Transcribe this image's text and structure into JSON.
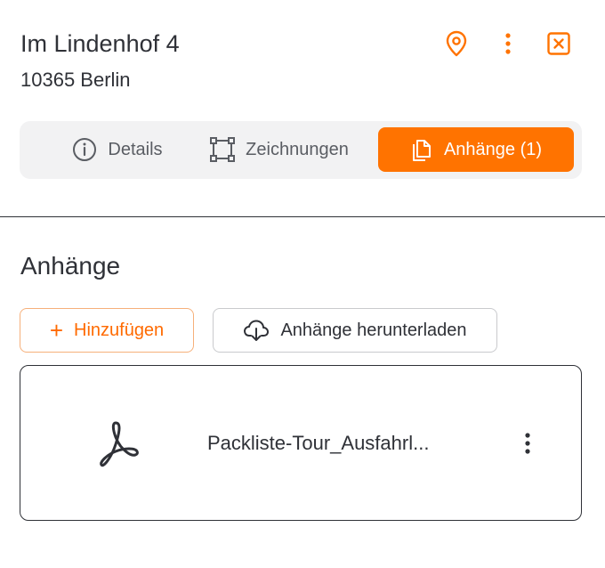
{
  "header": {
    "title": "Im Lindenhof 4",
    "subtitle": "10365 Berlin",
    "icons": [
      "map-pin-icon",
      "more-vertical-icon",
      "close-square-icon"
    ]
  },
  "tabs": [
    {
      "label": "Details",
      "icon": "info-circle-icon",
      "active": false
    },
    {
      "label": "Zeichnungen",
      "icon": "vector-square-icon",
      "active": false
    },
    {
      "label": "Anhänge (1)",
      "icon": "copy-files-icon",
      "active": true
    }
  ],
  "attachments": {
    "section_title": "Anhänge",
    "add_label": "Hinzufügen",
    "add_icon": "+",
    "download_label": "Anhänge herunterladen",
    "download_icon": "cloud-download-icon",
    "files": [
      {
        "name": "Packliste-Tour_Ausfahrl...",
        "icon": "pdf-icon"
      }
    ]
  },
  "colors": {
    "accent": "#ff7300",
    "text": "#2f3137",
    "tab_bg": "#f2f2f3",
    "muted": "#5a5d63"
  }
}
